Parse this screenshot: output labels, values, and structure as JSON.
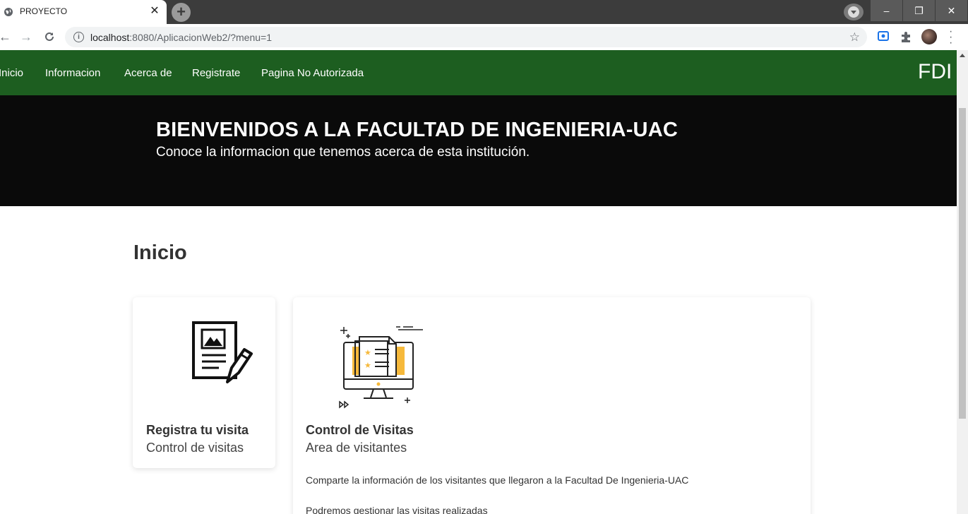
{
  "browser": {
    "tab_title": "PROYECTO",
    "tab_close": "✕",
    "new_tab": "+",
    "url_host": "localhost",
    "url_rest": ":8080/AplicacionWeb2/?menu=1",
    "window_minimize": "–",
    "window_restore": "❐",
    "window_close": "✕"
  },
  "navbar": {
    "items": [
      {
        "label": "Inicio"
      },
      {
        "label": "Informacion"
      },
      {
        "label": "Acerca de"
      },
      {
        "label": "Registrate"
      },
      {
        "label": "Pagina No Autorizada"
      }
    ],
    "brand": "FDI",
    "background": "#1d5e20"
  },
  "hero": {
    "title": "BIENVENIDOS A LA FACULTAD DE INGENIERIA-UAC",
    "subtitle": "Conoce la informacion que tenemos acerca de esta institución."
  },
  "main": {
    "title": "Inicio",
    "cards": [
      {
        "title": "Registra tu visita",
        "subtitle": "Control de visitas",
        "icon": "document-edit-icon"
      },
      {
        "title": "Control de Visitas",
        "subtitle": "Area de visitantes",
        "text1": "Comparte la información de los visitantes que llegaron a la Facultad De Ingenieria-UAC",
        "text2": "Podremos gestionar las visitas realizadas",
        "icon": "monitor-document-icon"
      }
    ]
  },
  "colors": {
    "accent_yellow": "#f6b93b",
    "hero_bg": "#0a0a0a"
  }
}
